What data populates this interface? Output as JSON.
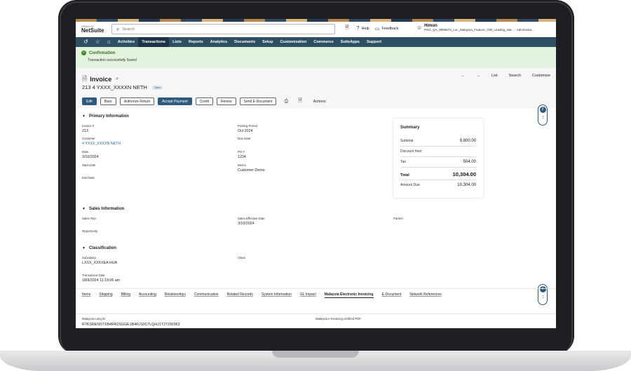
{
  "header": {
    "logo_top": "ORACLE",
    "logo_main": "NetSuite",
    "search_placeholder": "Search",
    "help": "Help",
    "feedback": "Feedback",
    "user_name": "Himon",
    "user_role": "PSG_QA_9899573_Loc_Malaysia_Feature_OW_Leading_Ma...  - Administra..."
  },
  "nav": {
    "items": [
      "Activities",
      "Transactions",
      "Lists",
      "Reports",
      "Analytics",
      "Documents",
      "Setup",
      "Customization",
      "Commerce",
      "SuiteApps",
      "Support"
    ],
    "active": "Transactions"
  },
  "confirmation": {
    "title": "Confirmation",
    "message": "Transaction successfully Saved"
  },
  "record": {
    "type": "Invoice",
    "subtitle": "213  4 YXXX_XXXXN NETH",
    "status": "Open",
    "nav": [
      "List",
      "Search",
      "Customize"
    ],
    "buttons": [
      "Edit",
      "Back",
      "Authorize Return",
      "Accept Payment",
      "Credit",
      "Renew",
      "Send E-Document"
    ],
    "actions_label": "Actions"
  },
  "primary": {
    "title": "Primary Information",
    "invoice_label": "Invoice #",
    "invoice": "213",
    "customer_label": "Customer",
    "customer": "4 YXXX_XXXXN NETH",
    "date_label": "Date",
    "date": "3/10/2024",
    "start_date_label": "Start Date",
    "end_date_label": "End Date",
    "posting_period_label": "Posting Period",
    "posting_period": "Oct 2024",
    "due_date_label": "Due Date",
    "po_label": "PO #",
    "po": "1234",
    "memo_label": "Memo",
    "memo": "Customer Demo"
  },
  "summary": {
    "title": "Summary",
    "subtotal_label": "Subtotal",
    "subtotal": "9,800.00",
    "discount_label": "Discount Item",
    "tax_label": "Tax",
    "tax": "504.00",
    "total_label": "Total",
    "total": "10,304.00",
    "amount_due_label": "Amount Due",
    "amount_due": "10,304.00"
  },
  "sales": {
    "title": "Sales Information",
    "sales_rep_label": "Sales Rep",
    "opportunity_label": "Opportunity",
    "effective_date_label": "Sales Effective Date",
    "effective_date": "3/10/2024",
    "partner_label": "Partner"
  },
  "classification": {
    "title": "Classification",
    "subsidiary_label": "Subsidiary",
    "subsidiary": "LXXX_XXXXEA HUA",
    "class_label": "Class",
    "transaction_date_label": "Transaction Date",
    "transaction_date": "18/9/2024 11:19:06 am"
  },
  "tabs": {
    "items": [
      "Items",
      "Shipping",
      "Billing",
      "Accounting",
      "Relationships",
      "Communication",
      "Related Records",
      "System Information",
      "GL Impact",
      "Malaysia Electronic Invoicing",
      "E-Document",
      "Network References"
    ],
    "active": "Malaysia Electronic Invoicing"
  },
  "einvoice": {
    "long_id_label": "Malaysia Long ID",
    "long_id": "R7KSRENSTXB4RR2SGGE1B4RJ10C7LQHJ1T27292963",
    "pdf_label": "Malaysia e-Invoicing certified PDF"
  }
}
